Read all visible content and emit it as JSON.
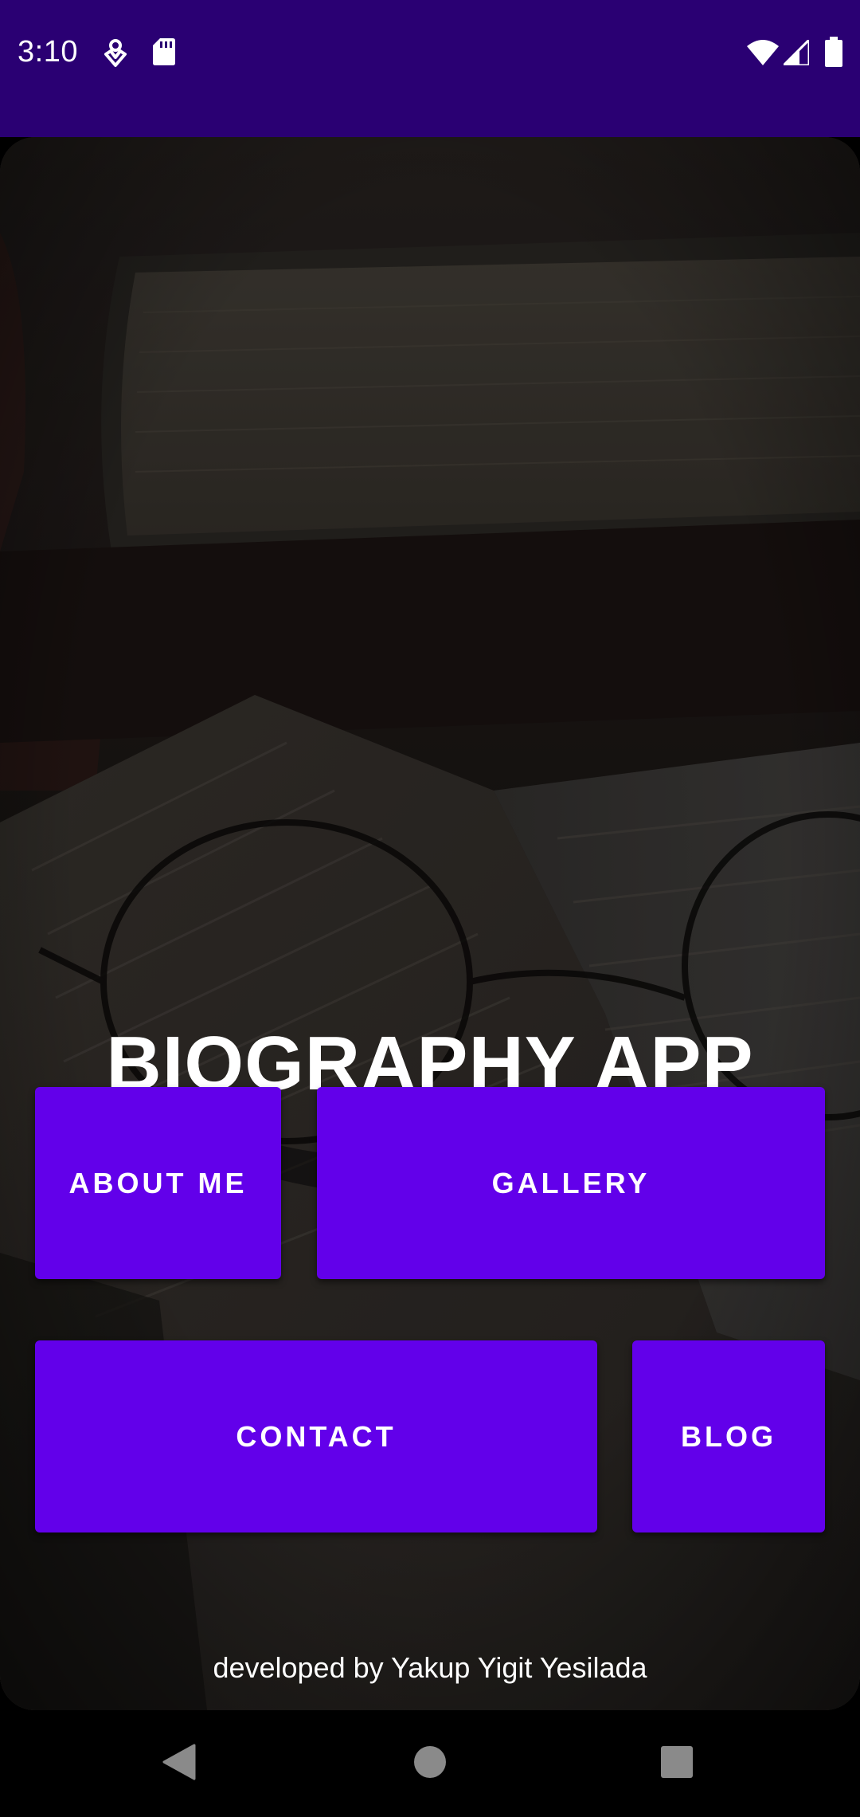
{
  "status_bar": {
    "time": "3:10",
    "background": "#2a0073",
    "icons_left": [
      "location-hint-icon",
      "sd-card-icon"
    ],
    "icons_right": [
      "wifi-icon",
      "cell-signal-icon",
      "battery-icon"
    ]
  },
  "main": {
    "title": "BIOGRAPHY APP",
    "buttons": {
      "about": "ABOUT ME",
      "gallery": "GALLERY",
      "contact": "CONTACT",
      "blog": "BLOG"
    },
    "button_color": "#6200ea",
    "footer": "developed by Yakup Yigit Yesilada"
  },
  "nav_bar": {
    "icons": [
      "back-icon",
      "home-icon",
      "recents-icon"
    ]
  }
}
